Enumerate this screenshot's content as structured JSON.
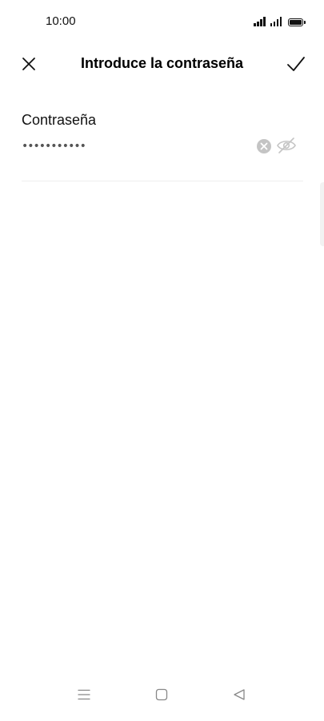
{
  "status_bar": {
    "time": "10:00",
    "icons": [
      "signal-icon",
      "signal-icon",
      "battery-icon"
    ]
  },
  "app_bar": {
    "title": "Introduce la contraseña",
    "left_icon": "close-icon",
    "right_icon": "checkmark-icon"
  },
  "password_field": {
    "label": "Contraseña",
    "value": "•••••••••••",
    "clear_icon": "clear-icon",
    "visibility_icon": "eye-off-icon"
  },
  "nav_bar": {
    "icons": [
      "menu-icon",
      "home-icon",
      "back-icon"
    ]
  },
  "colors": {
    "text": "#111111",
    "icon_grey": "#c4c4c4",
    "divider": "#eeeeee",
    "background": "#ffffff"
  }
}
